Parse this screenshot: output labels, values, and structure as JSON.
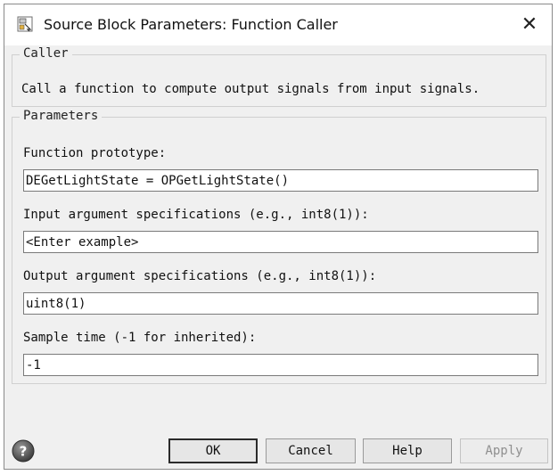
{
  "window": {
    "title": "Source Block Parameters: Function Caller",
    "close_glyph": "✕"
  },
  "caller": {
    "legend": "Caller",
    "description": "Call a function to compute output signals from input signals."
  },
  "parameters": {
    "legend": "Parameters",
    "function_prototype": {
      "label": "Function prototype:",
      "value": "DEGetLightState = OPGetLightState()"
    },
    "input_args": {
      "label": "Input argument specifications (e.g., int8(1)):",
      "value": "<Enter example>"
    },
    "output_args": {
      "label": "Output argument specifications (e.g., int8(1)):",
      "value": "uint8(1)"
    },
    "sample_time": {
      "label": "Sample time (-1 for inherited):",
      "value": "-1"
    }
  },
  "buttons": {
    "ok": "OK",
    "cancel": "Cancel",
    "help": "Help",
    "apply": "Apply"
  },
  "icons": {
    "app": "block-parameters-icon",
    "help": "help-question-icon"
  }
}
